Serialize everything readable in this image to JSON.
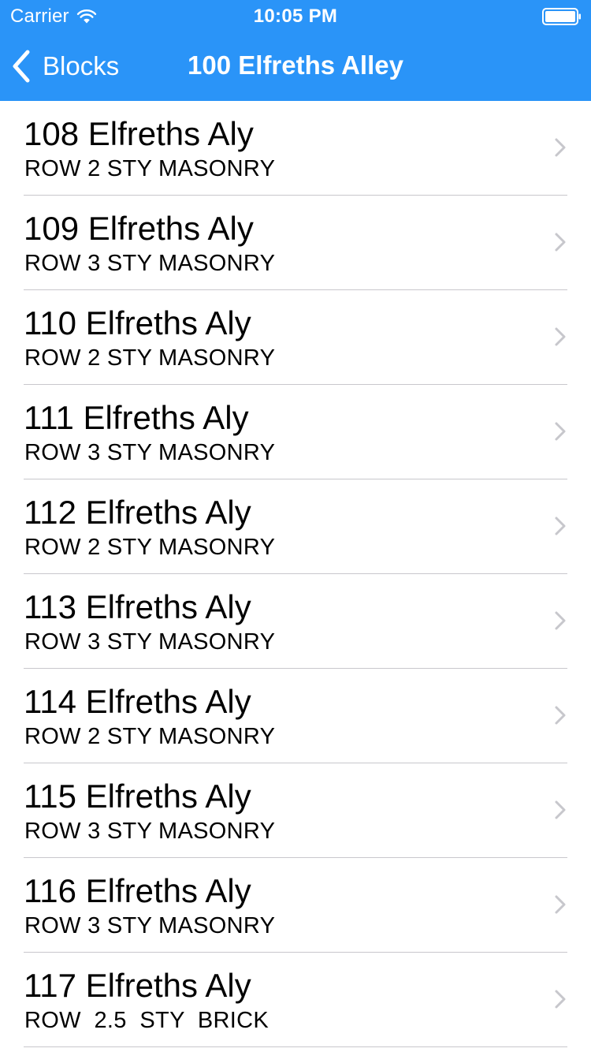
{
  "status_bar": {
    "carrier": "Carrier",
    "time": "10:05 PM",
    "wifi_icon": "wifi-icon",
    "battery_icon": "battery-icon"
  },
  "nav": {
    "back_label": "Blocks",
    "back_icon": "chevron-left-icon",
    "title": "100 Elfreths Alley"
  },
  "colors": {
    "nav_background": "#2a94f8",
    "separator": "#c8c7cc",
    "disclosure": "#c7c7cc"
  },
  "rows": [
    {
      "address": "108 Elfreths Aly",
      "description": "ROW 2 STY MASONRY"
    },
    {
      "address": "109 Elfreths Aly",
      "description": "ROW 3 STY MASONRY"
    },
    {
      "address": "110 Elfreths Aly",
      "description": "ROW 2 STY MASONRY"
    },
    {
      "address": "111 Elfreths Aly",
      "description": "ROW 3 STY MASONRY"
    },
    {
      "address": "112 Elfreths Aly",
      "description": "ROW 2 STY MASONRY"
    },
    {
      "address": "113 Elfreths Aly",
      "description": "ROW 3 STY MASONRY"
    },
    {
      "address": "114 Elfreths Aly",
      "description": "ROW 2 STY MASONRY"
    },
    {
      "address": "115 Elfreths Aly",
      "description": "ROW 3 STY MASONRY"
    },
    {
      "address": "116 Elfreths Aly",
      "description": "ROW 3 STY MASONRY"
    },
    {
      "address": "117 Elfreths Aly",
      "description": "ROW  2.5  STY  BRICK"
    }
  ]
}
